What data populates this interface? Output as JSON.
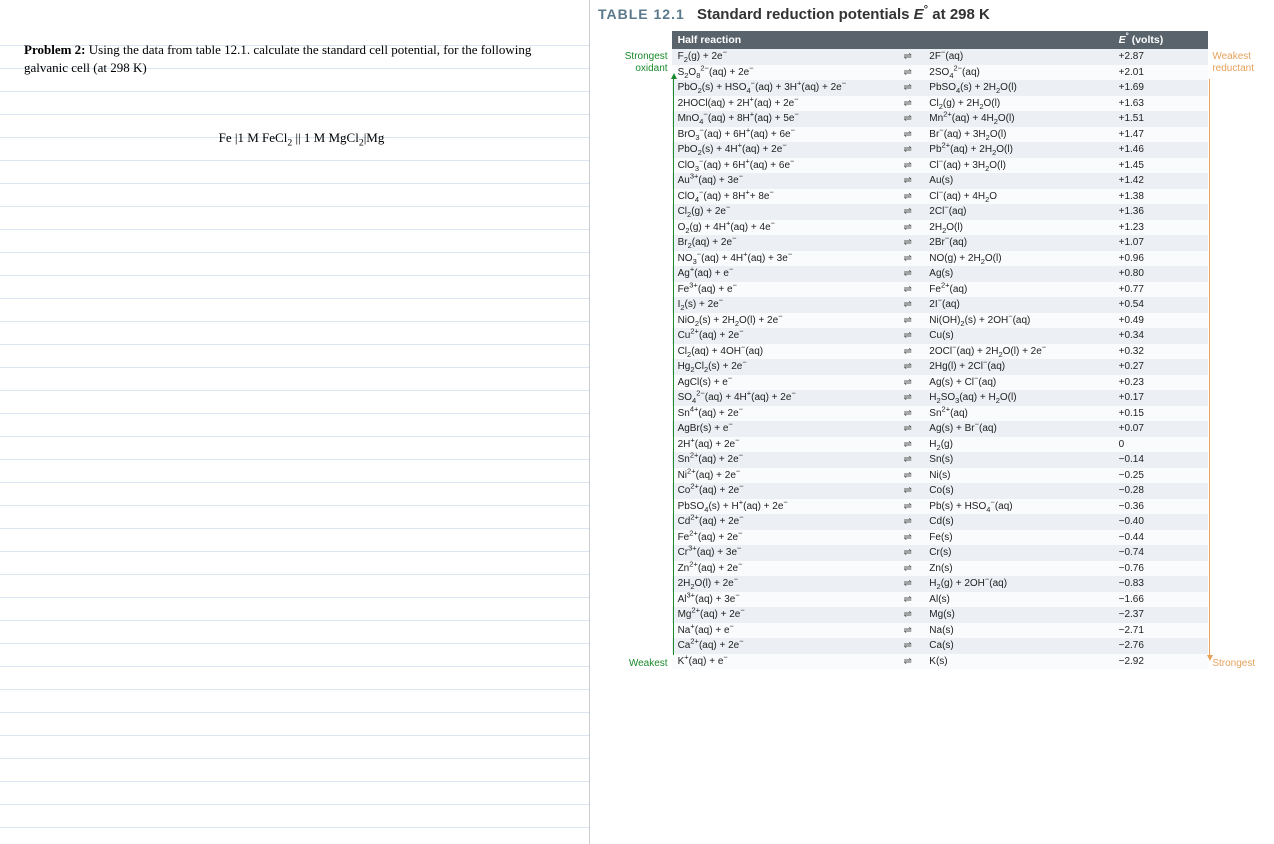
{
  "problem": {
    "label": "Problem 2:",
    "text": "Using the data from table 12.1. calculate the standard cell potential, for the following galvanic cell (at 298 K)",
    "cell_notation": "Fe |1 M FeCl₂ || 1 M MgCl₂|Mg"
  },
  "table": {
    "number": "TABLE 12.1",
    "title": "Standard reduction potentials E° at 298 K",
    "header_half_reaction": "Half reaction",
    "header_e": "E° (volts)",
    "guides": {
      "left_top": "Strongest oxidant",
      "left_bottom": "Weakest",
      "right_top": "Weakest reductant",
      "right_bottom": "Strongest"
    },
    "arrow_symbol": "⇌",
    "rows": [
      {
        "lhs": "F₂(g) + 2e⁻",
        "rhs": "2F⁻(aq)",
        "e": "+2.87"
      },
      {
        "lhs": "S₂O₈²⁻(aq) + 2e⁻",
        "rhs": "2SO₄²⁻(aq)",
        "e": "+2.01"
      },
      {
        "lhs": "PbO₂(s) + HSO₄⁻(aq) + 3H⁺(aq) + 2e⁻",
        "rhs": "PbSO₄(s) + 2H₂O(l)",
        "e": "+1.69"
      },
      {
        "lhs": "2HOCl(aq) + 2H⁺(aq) + 2e⁻",
        "rhs": "Cl₂(g) + 2H₂O(l)",
        "e": "+1.63"
      },
      {
        "lhs": "MnO₄⁻(aq) + 8H⁺(aq) + 5e⁻",
        "rhs": "Mn²⁺(aq) + 4H₂O(l)",
        "e": "+1.51"
      },
      {
        "lhs": "BrO₃⁻(aq) + 6H⁺(aq) + 6e⁻",
        "rhs": "Br⁻(aq) + 3H₂O(l)",
        "e": "+1.47"
      },
      {
        "lhs": "PbO₂(s) + 4H⁺(aq) + 2e⁻",
        "rhs": "Pb²⁺(aq) + 2H₂O(l)",
        "e": "+1.46"
      },
      {
        "lhs": "ClO₃⁻(aq) + 6H⁺(aq) + 6e⁻",
        "rhs": "Cl⁻(aq) + 3H₂O(l)",
        "e": "+1.45"
      },
      {
        "lhs": "Au³⁺(aq) + 3e⁻",
        "rhs": "Au(s)",
        "e": "+1.42"
      },
      {
        "lhs": "ClO₄⁻(aq) + 8H⁺+ 8e⁻",
        "rhs": "Cl⁻(aq) + 4H₂O",
        "e": "+1.38"
      },
      {
        "lhs": "Cl₂(g) + 2e⁻",
        "rhs": "2Cl⁻(aq)",
        "e": "+1.36"
      },
      {
        "lhs": "O₂(g) + 4H⁺(aq) + 4e⁻",
        "rhs": "2H₂O(l)",
        "e": "+1.23"
      },
      {
        "lhs": "Br₂(aq) + 2e⁻",
        "rhs": "2Br⁻(aq)",
        "e": "+1.07"
      },
      {
        "lhs": "NO₃⁻(aq) + 4H⁺(aq) + 3e⁻",
        "rhs": "NO(g) + 2H₂O(l)",
        "e": "+0.96"
      },
      {
        "lhs": "Ag⁺(aq) + e⁻",
        "rhs": "Ag(s)",
        "e": "+0.80"
      },
      {
        "lhs": "Fe³⁺(aq) + e⁻",
        "rhs": "Fe²⁺(aq)",
        "e": "+0.77"
      },
      {
        "lhs": "I₂(s) + 2e⁻",
        "rhs": "2I⁻(aq)",
        "e": "+0.54"
      },
      {
        "lhs": "NiO₂(s) + 2H₂O(l) + 2e⁻",
        "rhs": "Ni(OH)₂(s) + 2OH⁻(aq)",
        "e": "+0.49"
      },
      {
        "lhs": "Cu²⁺(aq) + 2e⁻",
        "rhs": "Cu(s)",
        "e": "+0.34"
      },
      {
        "lhs": "Cl₂(aq) + 4OH⁻(aq)",
        "rhs": "2OCl⁻(aq) + 2H₂O(l) + 2e⁻",
        "e": "+0.32"
      },
      {
        "lhs": "Hg₂Cl₂(s) + 2e⁻",
        "rhs": "2Hg(l) + 2Cl⁻(aq)",
        "e": "+0.27"
      },
      {
        "lhs": "AgCl(s) + e⁻",
        "rhs": "Ag(s) + Cl⁻(aq)",
        "e": "+0.23"
      },
      {
        "lhs": "SO₄²⁻(aq) + 4H⁺(aq) + 2e⁻",
        "rhs": "H₂SO₃(aq) + H₂O(l)",
        "e": "+0.17"
      },
      {
        "lhs": "Sn⁴⁺(aq) + 2e⁻",
        "rhs": "Sn²⁺(aq)",
        "e": "+0.15"
      },
      {
        "lhs": "AgBr(s) + e⁻",
        "rhs": "Ag(s) + Br⁻(aq)",
        "e": "+0.07"
      },
      {
        "lhs": "2H⁺(aq) + 2e⁻",
        "rhs": "H₂(g)",
        "e": "0"
      },
      {
        "lhs": "Sn²⁺(aq) + 2e⁻",
        "rhs": "Sn(s)",
        "e": "−0.14"
      },
      {
        "lhs": "Ni²⁺(aq) + 2e⁻",
        "rhs": "Ni(s)",
        "e": "−0.25"
      },
      {
        "lhs": "Co²⁺(aq) + 2e⁻",
        "rhs": "Co(s)",
        "e": "−0.28"
      },
      {
        "lhs": "PbSO₄(s) + H⁺(aq) + 2e⁻",
        "rhs": "Pb(s) + HSO₄⁻(aq)",
        "e": "−0.36"
      },
      {
        "lhs": "Cd²⁺(aq) + 2e⁻",
        "rhs": "Cd(s)",
        "e": "−0.40"
      },
      {
        "lhs": "Fe²⁺(aq) + 2e⁻",
        "rhs": "Fe(s)",
        "e": "−0.44"
      },
      {
        "lhs": "Cr³⁺(aq) + 3e⁻",
        "rhs": "Cr(s)",
        "e": "−0.74"
      },
      {
        "lhs": "Zn²⁺(aq) + 2e⁻",
        "rhs": "Zn(s)",
        "e": "−0.76"
      },
      {
        "lhs": "2H₂O(l) + 2e⁻",
        "rhs": "H₂(g) + 2OH⁻(aq)",
        "e": "−0.83"
      },
      {
        "lhs": "Al³⁺(aq) + 3e⁻",
        "rhs": "Al(s)",
        "e": "−1.66"
      },
      {
        "lhs": "Mg²⁺(aq) + 2e⁻",
        "rhs": "Mg(s)",
        "e": "−2.37"
      },
      {
        "lhs": "Na⁺(aq) + e⁻",
        "rhs": "Na(s)",
        "e": "−2.71"
      },
      {
        "lhs": "Ca²⁺(aq) + 2e⁻",
        "rhs": "Ca(s)",
        "e": "−2.76"
      },
      {
        "lhs": "K⁺(aq) + e⁻",
        "rhs": "K(s)",
        "e": "−2.92"
      }
    ]
  }
}
